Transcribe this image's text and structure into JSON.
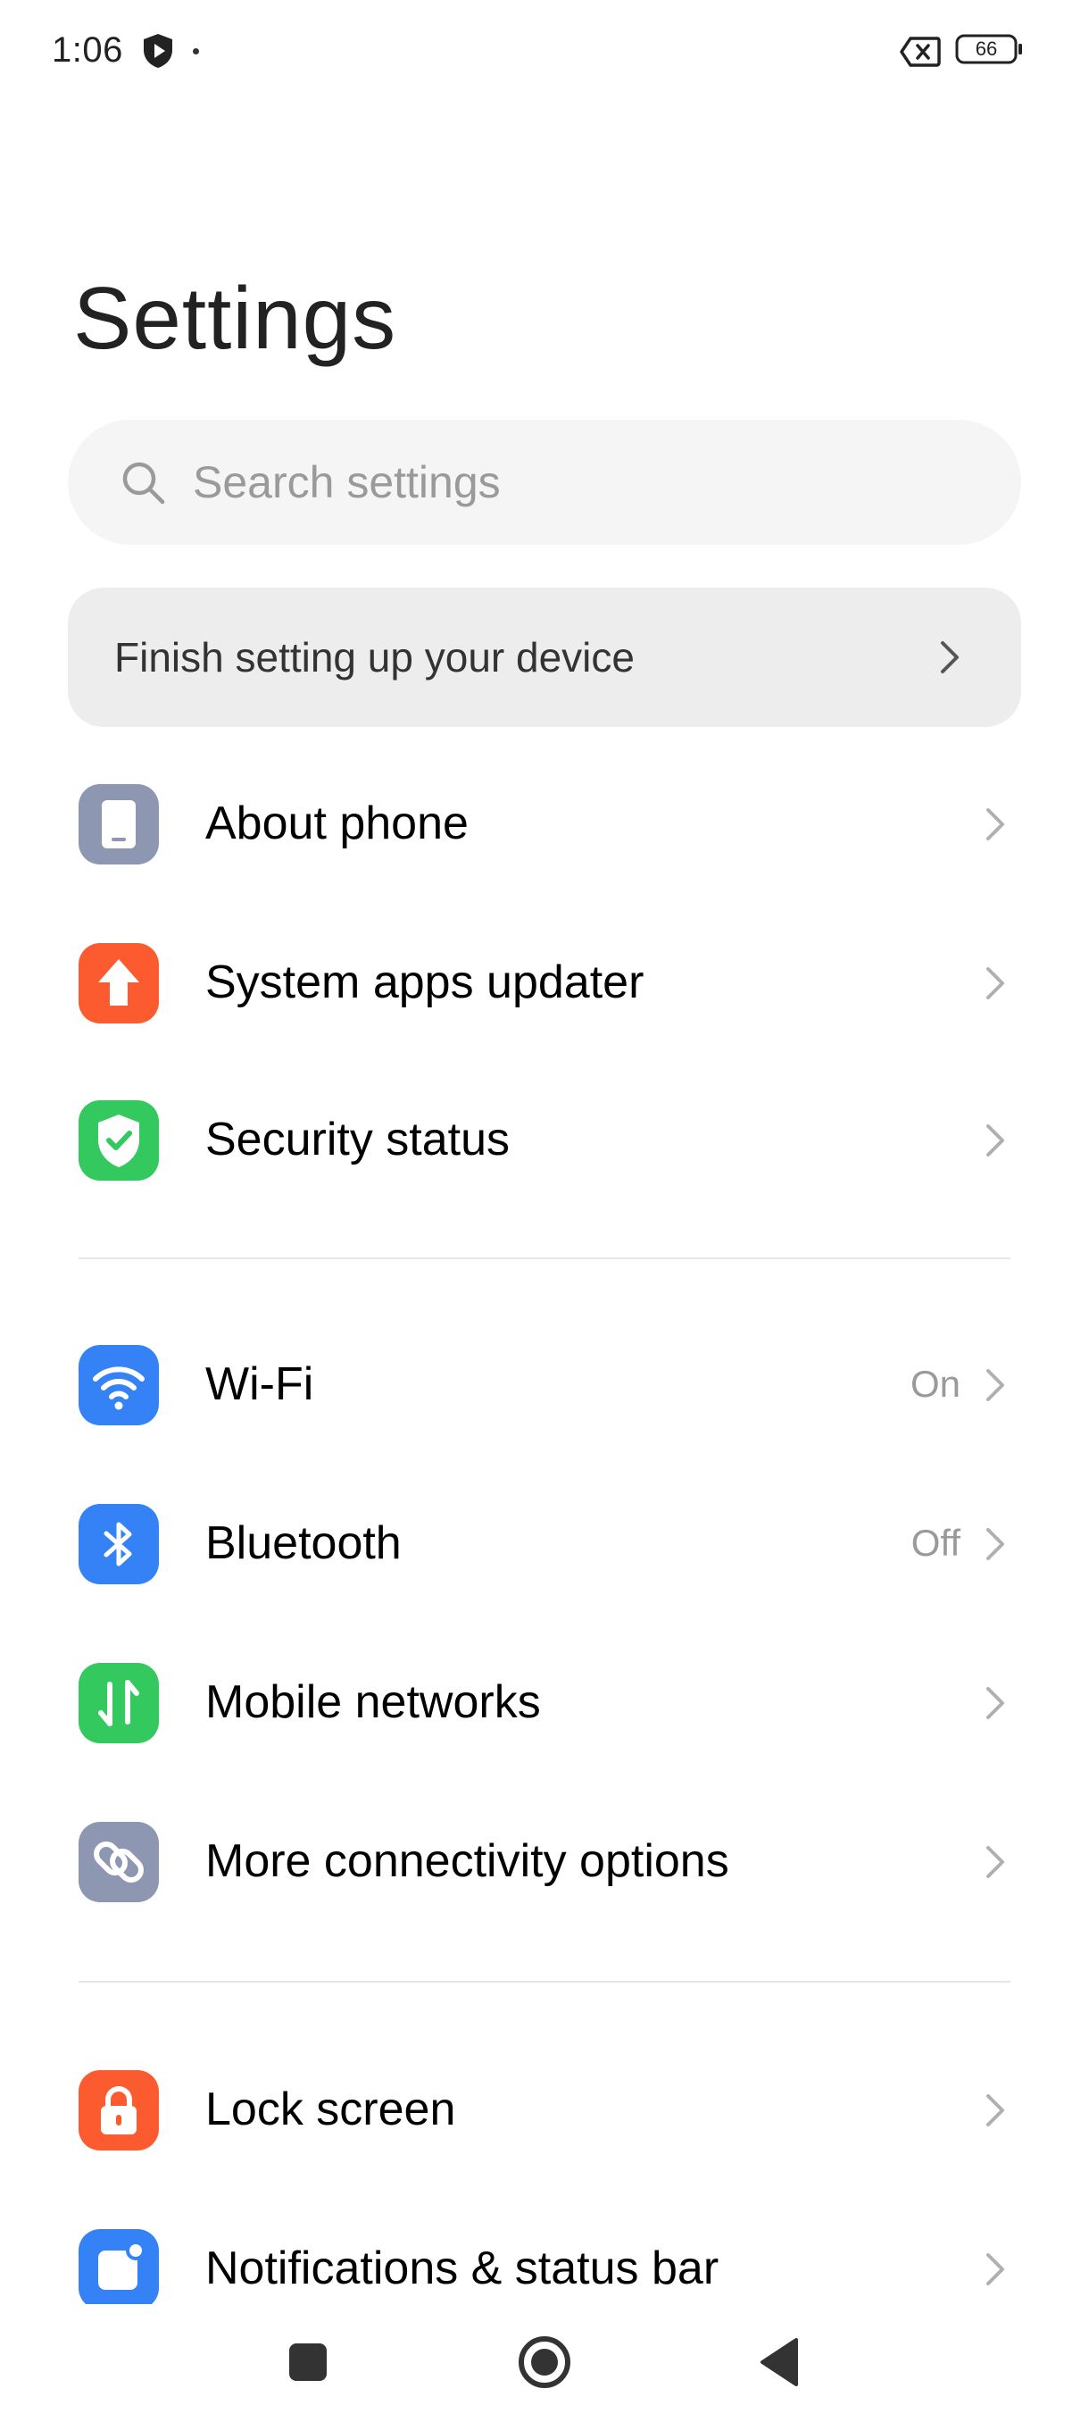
{
  "status_bar": {
    "time": "1:06",
    "battery_level": "66",
    "icons": [
      "shield-play-icon",
      "notification-dot-icon",
      "no-sim-icon",
      "battery-icon"
    ]
  },
  "page": {
    "title": "Settings"
  },
  "search": {
    "placeholder": "Search settings",
    "icon": "search-icon"
  },
  "setup_banner": {
    "label": "Finish setting up your device"
  },
  "groups": [
    {
      "items": [
        {
          "id": "about-phone",
          "label": "About phone",
          "icon": "phone-icon",
          "icon_color": "#8e97b2",
          "value": ""
        },
        {
          "id": "system-apps-updater",
          "label": "System apps updater",
          "icon": "arrow-up-icon",
          "icon_color": "#fb5b2e",
          "value": ""
        },
        {
          "id": "security-status",
          "label": "Security status",
          "icon": "shield-check-icon",
          "icon_color": "#33c95e",
          "value": ""
        }
      ]
    },
    {
      "items": [
        {
          "id": "wifi",
          "label": "Wi-Fi",
          "icon": "wifi-icon",
          "icon_color": "#3482f6",
          "value": "On"
        },
        {
          "id": "bluetooth",
          "label": "Bluetooth",
          "icon": "bluetooth-icon",
          "icon_color": "#3482f6",
          "value": "Off"
        },
        {
          "id": "mobile-networks",
          "label": "Mobile networks",
          "icon": "mobile-data-icon",
          "icon_color": "#33c95e",
          "value": ""
        },
        {
          "id": "more-connectivity",
          "label": "More connectivity options",
          "icon": "link-icon",
          "icon_color": "#8e97b2",
          "value": ""
        }
      ]
    },
    {
      "items": [
        {
          "id": "lock-screen",
          "label": "Lock screen",
          "icon": "lock-icon",
          "icon_color": "#fb5b2e",
          "value": ""
        },
        {
          "id": "notifications",
          "label": "Notifications & status bar",
          "icon": "notification-icon",
          "icon_color": "#3482f6",
          "value": ""
        }
      ]
    }
  ],
  "nav_bar": {
    "buttons": [
      "recents-button",
      "home-button",
      "back-button"
    ]
  },
  "colors": {
    "background": "#ffffff",
    "search_bg": "#f5f5f5",
    "banner_bg": "#ededed",
    "secondary_text": "#9a9a9a",
    "chevron": "#b0b0b0"
  }
}
